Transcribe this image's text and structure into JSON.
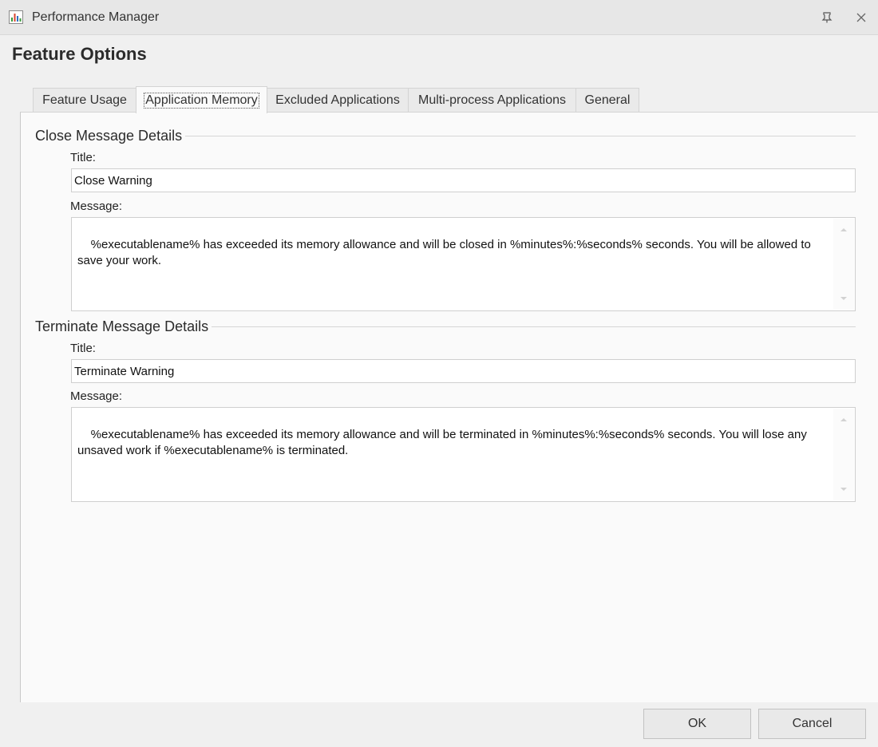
{
  "window": {
    "title": "Performance Manager",
    "icon": "performance-chart-icon",
    "controls": {
      "pin_icon": "pin-icon",
      "close_icon": "close-icon"
    }
  },
  "heading": "Feature Options",
  "tabs": [
    {
      "label": "Feature Usage",
      "active": false
    },
    {
      "label": "Application Memory",
      "active": true
    },
    {
      "label": "Excluded Applications",
      "active": false
    },
    {
      "label": "Multi-process Applications",
      "active": false
    },
    {
      "label": "General",
      "active": false
    }
  ],
  "close_group": {
    "title": "Close Message Details",
    "title_label": "Title:",
    "title_value": "Close Warning",
    "message_label": "Message:",
    "message_value": "%executablename% has exceeded its memory allowance and will be closed in %minutes%:%seconds% seconds. You will be allowed to save your work."
  },
  "terminate_group": {
    "title": "Terminate Message Details",
    "title_label": "Title:",
    "title_value": "Terminate Warning",
    "message_label": "Message:",
    "message_value": "%executablename% has exceeded its memory allowance and will be terminated in %minutes%:%seconds% seconds. You will lose any unsaved work if %executablename% is terminated."
  },
  "buttons": {
    "ok": "OK",
    "cancel": "Cancel"
  },
  "colors": {
    "background": "#f0f0f0",
    "panel": "#fafafa",
    "titlebar": "#e7e7e7"
  }
}
